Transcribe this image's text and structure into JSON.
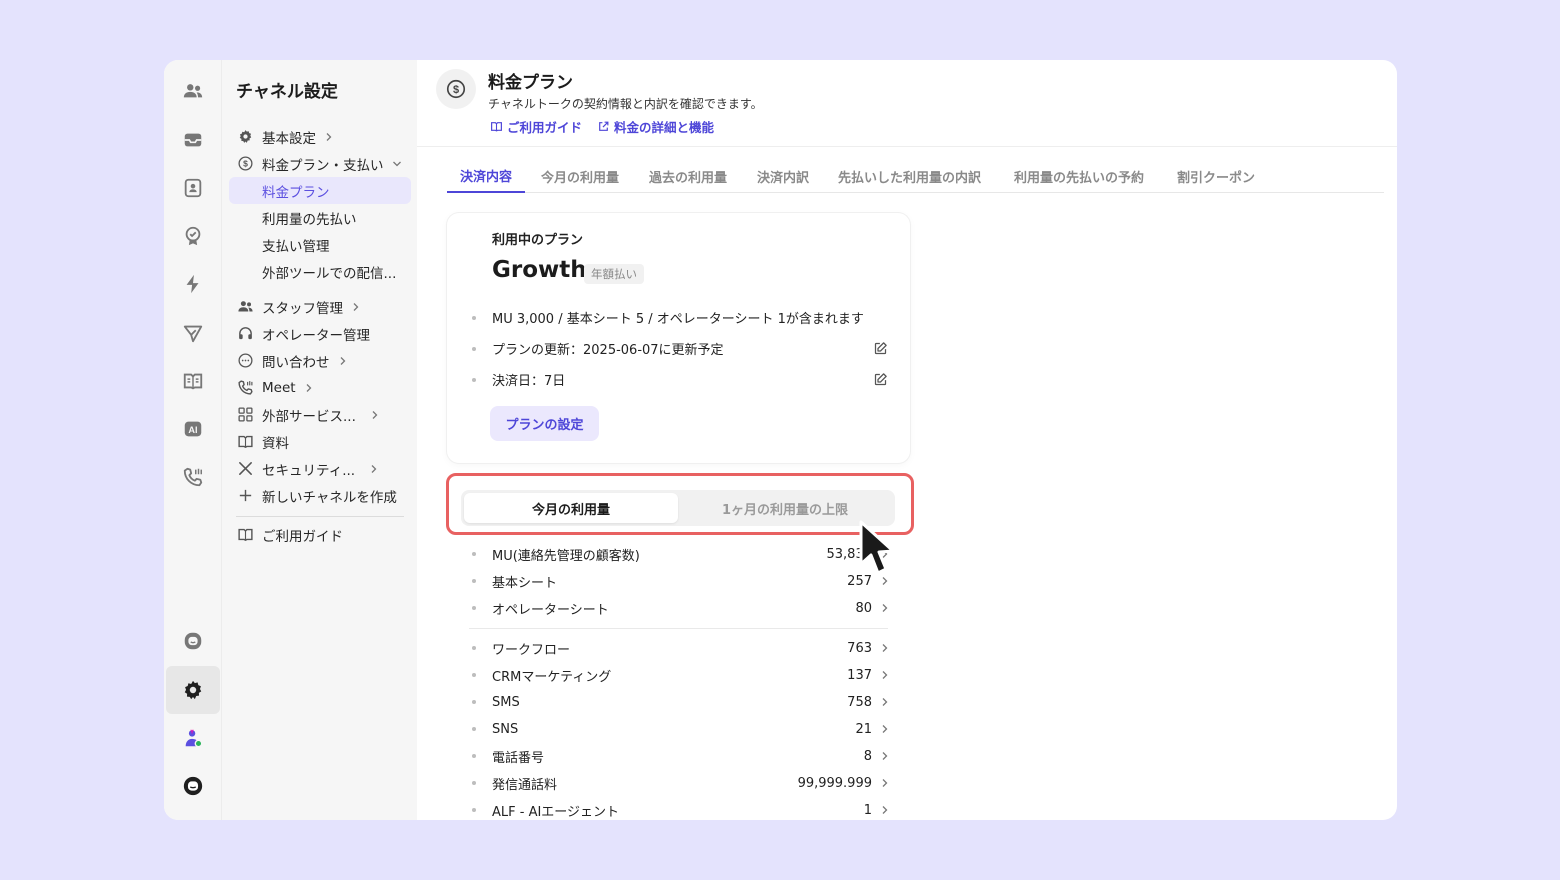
{
  "rail": {
    "icons": [
      "people-icon",
      "inbox-icon",
      "contacts-icon",
      "badge-icon",
      "bolt-icon",
      "send-icon",
      "book-icon",
      "ai-icon",
      "phone-icon",
      "chat-bubble-icon",
      "gear-icon",
      "avatar-icon",
      "channel-logo-icon"
    ],
    "ai_label": "AI"
  },
  "nav": {
    "title": "チャネル設定",
    "items": [
      {
        "label": "基本設定"
      },
      {
        "label": "料金プラン・支払い"
      },
      {
        "label": "料金プラン"
      },
      {
        "label": "利用量の先払い"
      },
      {
        "label": "支払い管理"
      },
      {
        "label": "外部ツールでの配信..."
      },
      {
        "label": "スタッフ管理"
      },
      {
        "label": "オペレーター管理"
      },
      {
        "label": "問い合わせ"
      },
      {
        "label": "Meet"
      },
      {
        "label": "外部サービス..."
      },
      {
        "label": "資料"
      },
      {
        "label": "セキュリティ..."
      },
      {
        "label": "新しいチャネルを作成"
      },
      {
        "label": "ご利用ガイド"
      }
    ]
  },
  "header": {
    "title": "料金プラン",
    "description": "チャネルトークの契約情報と内訳を確認できます。",
    "links": [
      "ご利用ガイド",
      "料金の詳細と機能"
    ]
  },
  "tabs": [
    "決済内容",
    "今月の利用量",
    "過去の利用量",
    "決済内訳",
    "先払いした利用量の内訳",
    "利用量の先払いの予約",
    "割引クーポン"
  ],
  "plan": {
    "label": "利用中のプラン",
    "name": "Growth",
    "badge": "年額払い",
    "lines": [
      "MU 3,000 / 基本シート 5 / オペレーターシート 1が含まれます",
      "プランの更新：2025-06-07に更新予定",
      "決済日：7日"
    ],
    "button": "プランの設定"
  },
  "segment": {
    "on": "今月の利用量",
    "off": "1ヶ月の利用量の上限"
  },
  "usage": [
    {
      "name": "MU(連絡先管理の顧客数)",
      "value": "53,837"
    },
    {
      "name": "基本シート",
      "value": "257"
    },
    {
      "name": "オペレーターシート",
      "value": "80"
    },
    {
      "name": "ワークフロー",
      "value": "763"
    },
    {
      "name": "CRMマーケティング",
      "value": "137"
    },
    {
      "name": "SMS",
      "value": "758"
    },
    {
      "name": "SNS",
      "value": "21"
    },
    {
      "name": "電話番号",
      "value": "8"
    },
    {
      "name": "発信通話料",
      "value": "99,999.999"
    },
    {
      "name": "ALF - AIエージェント",
      "value": "1"
    }
  ],
  "colors": {
    "accent": "#4e46d8",
    "highlight_border": "#e86161",
    "background": "#e4e3fd"
  }
}
